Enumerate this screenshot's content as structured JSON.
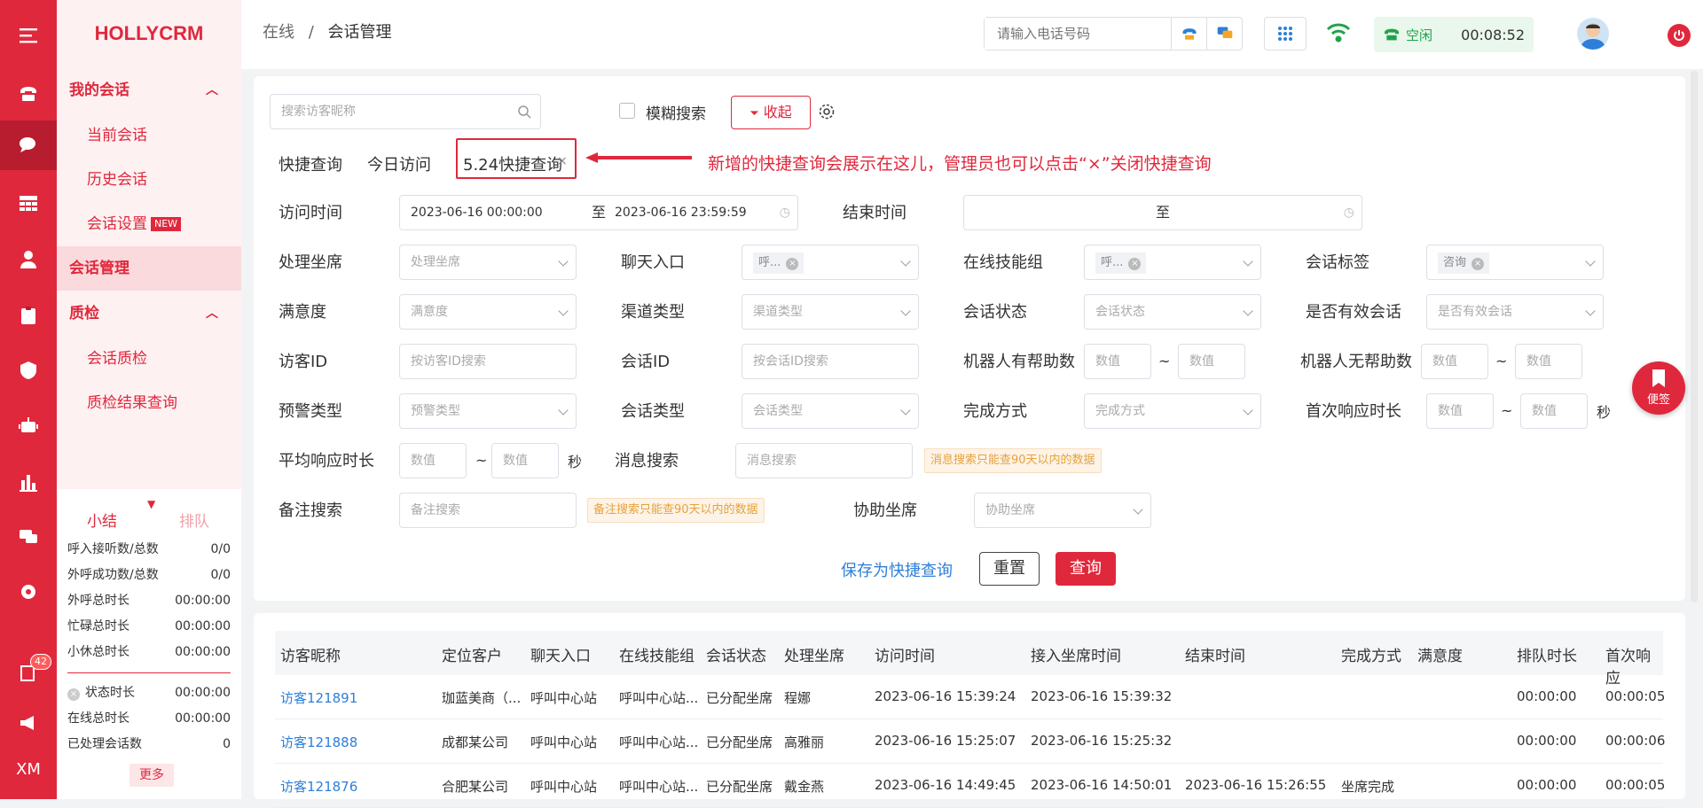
{
  "app": {
    "logo": "HOLLYCRM"
  },
  "rail": {
    "badge": "42",
    "bottom_label": "XM"
  },
  "sidebar": {
    "group1": "我的会话",
    "items1": [
      "当前会话",
      "历史会话",
      "会话设置"
    ],
    "new_badge": "NEW",
    "active": "会话管理",
    "group2": "质检",
    "items2": [
      "会话质检",
      "质检结果查询"
    ]
  },
  "stats": {
    "tab1": "小结",
    "tab2": "排队",
    "rows": [
      {
        "label": "呼入接听数/总数",
        "value": "0/0"
      },
      {
        "label": "外呼成功数/总数",
        "value": "0/0"
      },
      {
        "label": "外呼总时长",
        "value": "00:00:00"
      },
      {
        "label": "忙碌总时长",
        "value": "00:00:00"
      },
      {
        "label": "小休总时长",
        "value": "00:00:00"
      }
    ],
    "rows2": [
      {
        "label": "状态时长",
        "value": "00:00:00"
      },
      {
        "label": "在线总时长",
        "value": "00:00:00"
      },
      {
        "label": "已处理会话数",
        "value": "0"
      }
    ],
    "more": "更多"
  },
  "topbar": {
    "crumb1": "在线",
    "crumb_sep": "/",
    "crumb2": "会话管理",
    "phone_placeholder": "请输入电话号码",
    "status": "空闲",
    "timer": "00:08:52"
  },
  "search": {
    "nickname_placeholder": "搜索访客昵称",
    "fuzzy": "模糊搜索",
    "collapse": "收起"
  },
  "quick": {
    "label": "快捷查询",
    "today": "今日访问",
    "custom": "5.24快捷查询",
    "close": "×",
    "annotation": "新增的快捷查询会展示在这儿，管理员也可以点击“×”关闭快捷查询"
  },
  "form": {
    "visit_time": "访问时间",
    "visit_start": "2023-06-16 00:00:00",
    "to": "至",
    "visit_end": "2023-06-16 23:59:59",
    "end_time": "结束时间",
    "agent": "处理坐席",
    "agent_ph": "处理坐席",
    "entry": "聊天入口",
    "entry_chip": "呼...",
    "skill": "在线技能组",
    "skill_chip": "呼...",
    "tag": "会话标签",
    "tag_chip": "咨询",
    "satisfaction": "满意度",
    "satisfaction_ph": "满意度",
    "channel": "渠道类型",
    "channel_ph": "渠道类型",
    "state": "会话状态",
    "state_ph": "会话状态",
    "valid": "是否有效会话",
    "valid_ph": "是否有效会话",
    "visitor_id": "访客ID",
    "visitor_id_ph": "按访客ID搜索",
    "session_id": "会话ID",
    "session_id_ph": "按会话ID搜索",
    "bot_help": "机器人有帮助数",
    "bot_nohelp": "机器人无帮助数",
    "num_ph": "数值",
    "tilde": "~",
    "warn": "预警类型",
    "warn_ph": "预警类型",
    "session_type": "会话类型",
    "session_type_ph": "会话类型",
    "finish": "完成方式",
    "finish_ph": "完成方式",
    "first_resp": "首次响应时长",
    "sec": "秒",
    "avg_resp": "平均响应时长",
    "msg": "消息搜索",
    "msg_ph": "消息搜索",
    "msg_hint": "消息搜索只能查90天以内的数据",
    "note": "备注搜索",
    "note_ph": "备注搜索",
    "note_hint": "备注搜索只能查90天以内的数据",
    "assist": "协助坐席",
    "assist_ph": "协助坐席",
    "save": "保存为快捷查询",
    "reset": "重置",
    "query": "查询"
  },
  "table": {
    "headers": [
      "访客昵称",
      "定位客户",
      "聊天入口",
      "在线技能组",
      "会话状态",
      "处理坐席",
      "访问时间",
      "接入坐席时间",
      "结束时间",
      "完成方式",
      "满意度",
      "排队时长",
      "首次响应"
    ],
    "rows": [
      [
        "访客121891",
        "珈蓝美商（...",
        "呼叫中心站",
        "呼叫中心站...",
        "已分配坐席",
        "程娜",
        "2023-06-16 15:39:24",
        "2023-06-16 15:39:32",
        "",
        "",
        "",
        "00:00:00",
        "00:00:05"
      ],
      [
        "访客121888",
        "成都某公司",
        "呼叫中心站",
        "呼叫中心站...",
        "已分配坐席",
        "高雅丽",
        "2023-06-16 15:25:07",
        "2023-06-16 15:25:32",
        "",
        "",
        "",
        "00:00:00",
        "00:00:06"
      ],
      [
        "访客121876",
        "合肥某公司",
        "呼叫中心站",
        "呼叫中心站...",
        "已分配坐席",
        "戴金燕",
        "2023-06-16 14:49:45",
        "2023-06-16 14:50:01",
        "2023-06-16 15:26:55",
        "坐席完成",
        "",
        "00:00:00",
        "00:00:05"
      ]
    ]
  },
  "float_btn": "便签",
  "colors": {
    "brand": "#e0283c",
    "link": "#2d7fd9",
    "online": "#1fa34a"
  }
}
